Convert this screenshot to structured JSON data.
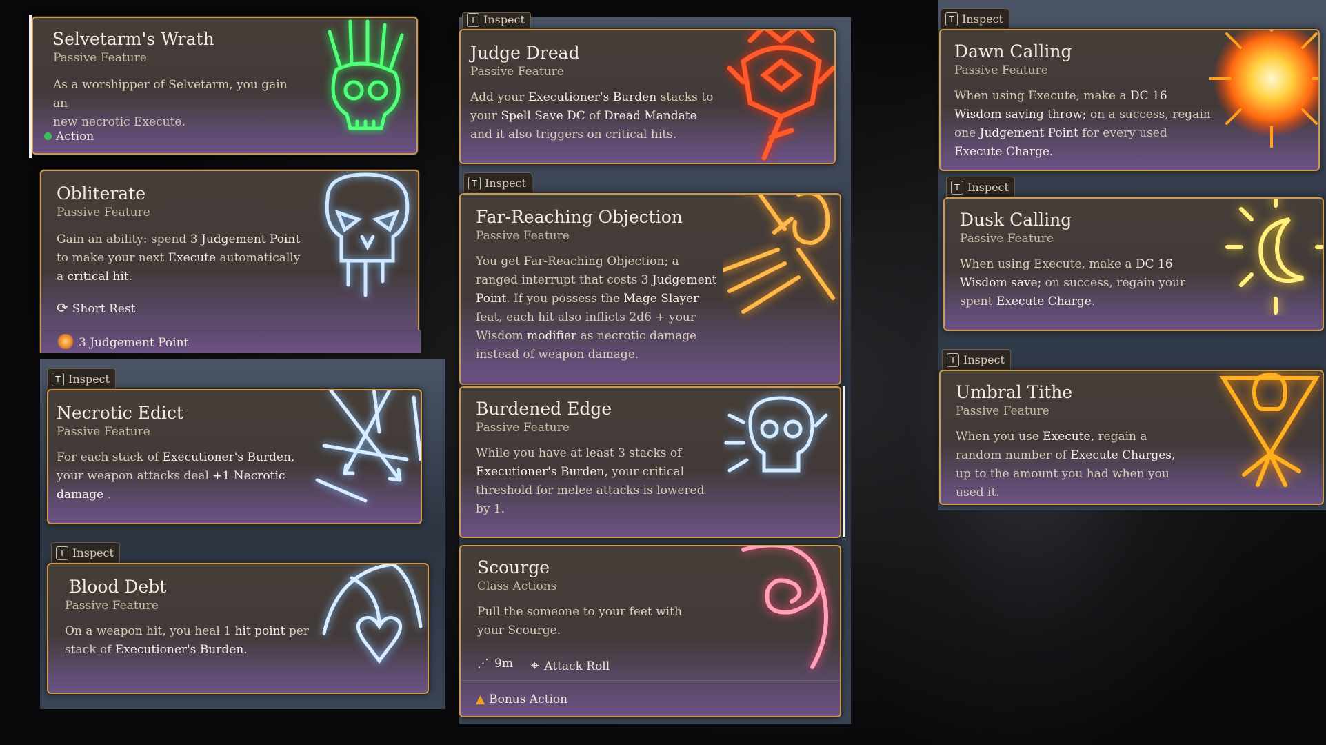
{
  "colors": {
    "card_border": "#c99a57",
    "card_top": "#463e38",
    "card_bottom": "#6d5286",
    "action_dot": "#3fbf5f",
    "bonus_action": "#f0a020"
  },
  "inspect_label": "Inspect",
  "inspect_key": "T",
  "cards": {
    "selvetarm": {
      "title": "Selvetarm's Wrath",
      "subtitle": "Passive Feature",
      "desc": [
        "As a worshipper of Selvetarm, you gain an",
        "new necrotic Execute."
      ],
      "footer": "Action",
      "icon": "green-skull-icon"
    },
    "obliterate": {
      "title": "Obliterate",
      "subtitle": "Passive Feature",
      "desc_pre": "Gain an ability: spend 3",
      "desc_b1": "Judgement Point",
      "desc_mid": "to make your next",
      "desc_b2": "Execute",
      "desc_mid2": "automatically a",
      "desc_b3": "critical hit",
      "desc_end": ".",
      "recharge": "Short Rest",
      "cost": "3 Judgement Point",
      "icon": "dripping-skull-icon"
    },
    "necrotic_edict": {
      "title": "Necrotic Edict",
      "subtitle": "Passive Feature",
      "desc_pre": "For each stack of",
      "desc_b1": "Executioner's Burden,",
      "desc_mid": "your weapon attacks deal",
      "desc_b2": "+1 Necrotic",
      "desc_b3": "damage",
      "desc_end": " .",
      "icon": "crossed-arrows-icon"
    },
    "blood_debt": {
      "title": "Blood Debt",
      "subtitle": "Passive Feature",
      "desc_pre": "On a weapon hit, you heal 1",
      "desc_b1": "hit point",
      "desc_mid": "per stack of",
      "desc_b2": "Executioner's Burden.",
      "icon": "scythe-heart-icon"
    },
    "judge_dread": {
      "title": "Judge Dread",
      "subtitle": "Passive Feature",
      "desc_pre": "Add your",
      "desc_b1": "Executioner's Burden",
      "desc_mid": "stacks to your",
      "desc_b2": "Spell Save DC",
      "desc_mid2": "of",
      "desc_b3": "Dread Mandate",
      "desc_end": "and it also triggers on critical hits.",
      "icon": "red-helm-icon"
    },
    "far_reaching": {
      "title": "Far-Reaching Objection",
      "subtitle": "Passive Feature",
      "desc_pre": "You get Far-Reaching Objection; a ranged interrupt that costs 3",
      "desc_b1": "Judgement Point",
      "desc_mid": ". If you possess the",
      "desc_b2": "Mage Slayer",
      "desc_mid2": "feat, each hit also inflicts 2d6 + your Wisdom",
      "desc_b3": "modifier",
      "desc_end": "as necrotic damage instead of weapon damage.",
      "icon": "sword-hand-icon"
    },
    "burdened_edge": {
      "title": "Burdened Edge",
      "subtitle": "Passive Feature",
      "desc_pre": "While you have at least 3 stacks of",
      "desc_b1": "Executioner's Burden,",
      "desc_end": "your critical threshold for melee attacks is lowered by 1.",
      "icon": "blue-skull-icon"
    },
    "scourge": {
      "title": "Scourge",
      "subtitle": "Class Actions",
      "desc": "Pull the someone to your feet with your Scourge.",
      "range": "9m",
      "roll": "Attack Roll",
      "footer": "Bonus Action",
      "icon": "whip-spiral-icon"
    },
    "dawn_calling": {
      "title": "Dawn Calling",
      "subtitle": "Passive Feature",
      "desc_pre": "When using Execute, make a",
      "desc_b1": "DC 16 Wisdom saving throw;",
      "desc_mid": "on a success, regain one",
      "desc_b2": "Judgement Point",
      "desc_mid2": "for every used",
      "desc_b3": "Execute Charge.",
      "icon": "sun-icon"
    },
    "dusk_calling": {
      "title": "Dusk Calling",
      "subtitle": "Passive Feature",
      "desc_pre": "When using Execute, make a",
      "desc_b1": "DC 16 Wisdom save;",
      "desc_mid": "on success, regain your spent",
      "desc_b2": "Execute Charge.",
      "icon": "moon-sun-icon"
    },
    "umbral_tithe": {
      "title": "Umbral Tithe",
      "subtitle": "Passive Feature",
      "desc_pre": "When you use",
      "desc_b1": "Execute,",
      "desc_mid": "regain a random number of",
      "desc_b2": "Execute Charges,",
      "desc_end": "up to the amount you had when you used it.",
      "icon": "skull-triangle-icon"
    }
  }
}
